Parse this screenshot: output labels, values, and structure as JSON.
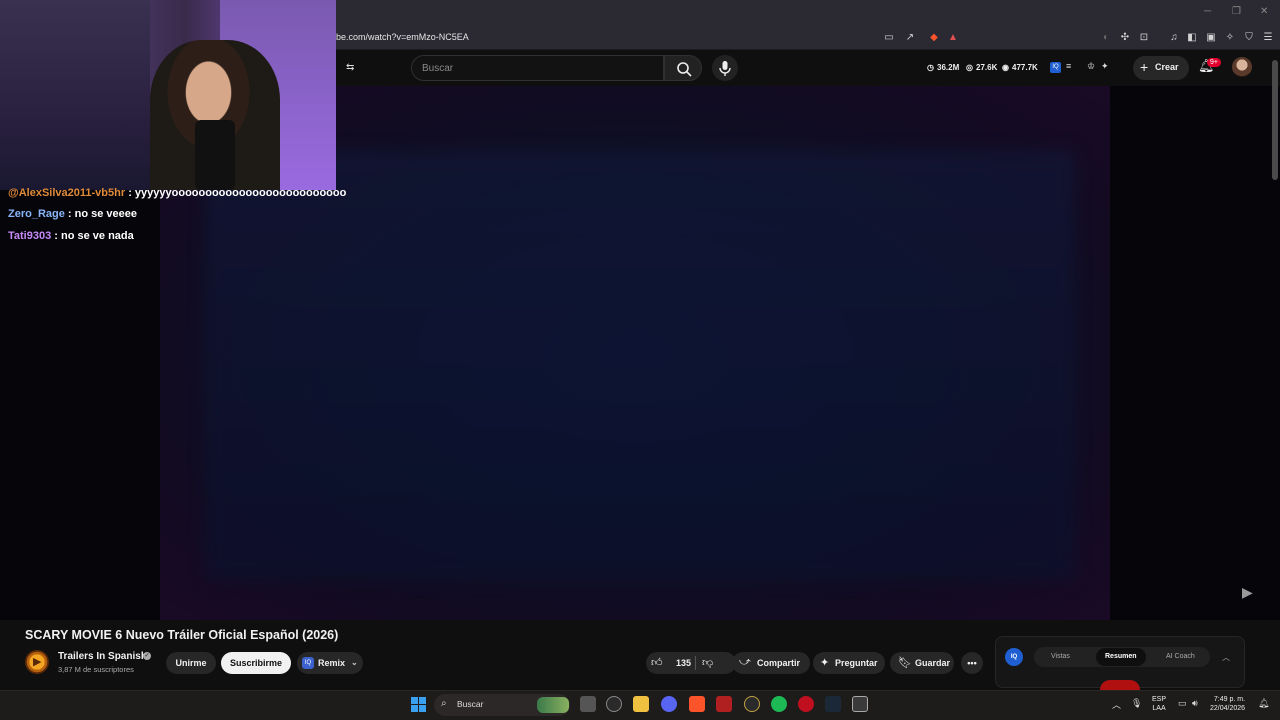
{
  "browser": {
    "url": "be.com/watch?v=emMzo-NC5EA"
  },
  "header": {
    "search_placeholder": "Buscar",
    "stats": {
      "views": "36.2M",
      "likes": "27.6K",
      "viewers": "477.7K"
    },
    "create_label": "Crear",
    "notifications_badge": "9+"
  },
  "chat": {
    "messages": [
      {
        "user": "@AlexSilva2011-vb5hr",
        "text": ": yyyyyyoooooooooooooooooooooooooo",
        "color": "#e08a3a"
      },
      {
        "user": "Zero_Rage",
        "text": ": no se veeee",
        "color": "#8ab4f8"
      },
      {
        "user": "Tati9303",
        "text": ": no se ve nada",
        "color": "#c58af9"
      }
    ]
  },
  "video": {
    "title": "SCARY MOVIE 6 Nuevo Tráiler Oficial Español (2026)",
    "channel": {
      "name": "Trailers In Spanish",
      "subscribers": "3,87 M de suscriptores"
    },
    "buttons": {
      "join": "Unirme",
      "subscribe": "Suscribirme",
      "remix": "Remix",
      "likes": "135",
      "share": "Compartir",
      "ask": "Preguntar",
      "save": "Guardar"
    }
  },
  "iq_panel": {
    "logo": "IQ",
    "tabs": [
      "Vistas",
      "Resumen",
      "AI Coach"
    ],
    "active_tab": "Resumen"
  },
  "taskbar": {
    "search_label": "Buscar",
    "lang_line1": "ESP",
    "lang_line2": "LAA",
    "time": "7:49 p. m.",
    "date": "22/04/2026"
  },
  "colors": {
    "accent_red": "#e1002d",
    "subscribe_bg": "#f1f1f1",
    "iq_blue": "#1f5fd1"
  }
}
